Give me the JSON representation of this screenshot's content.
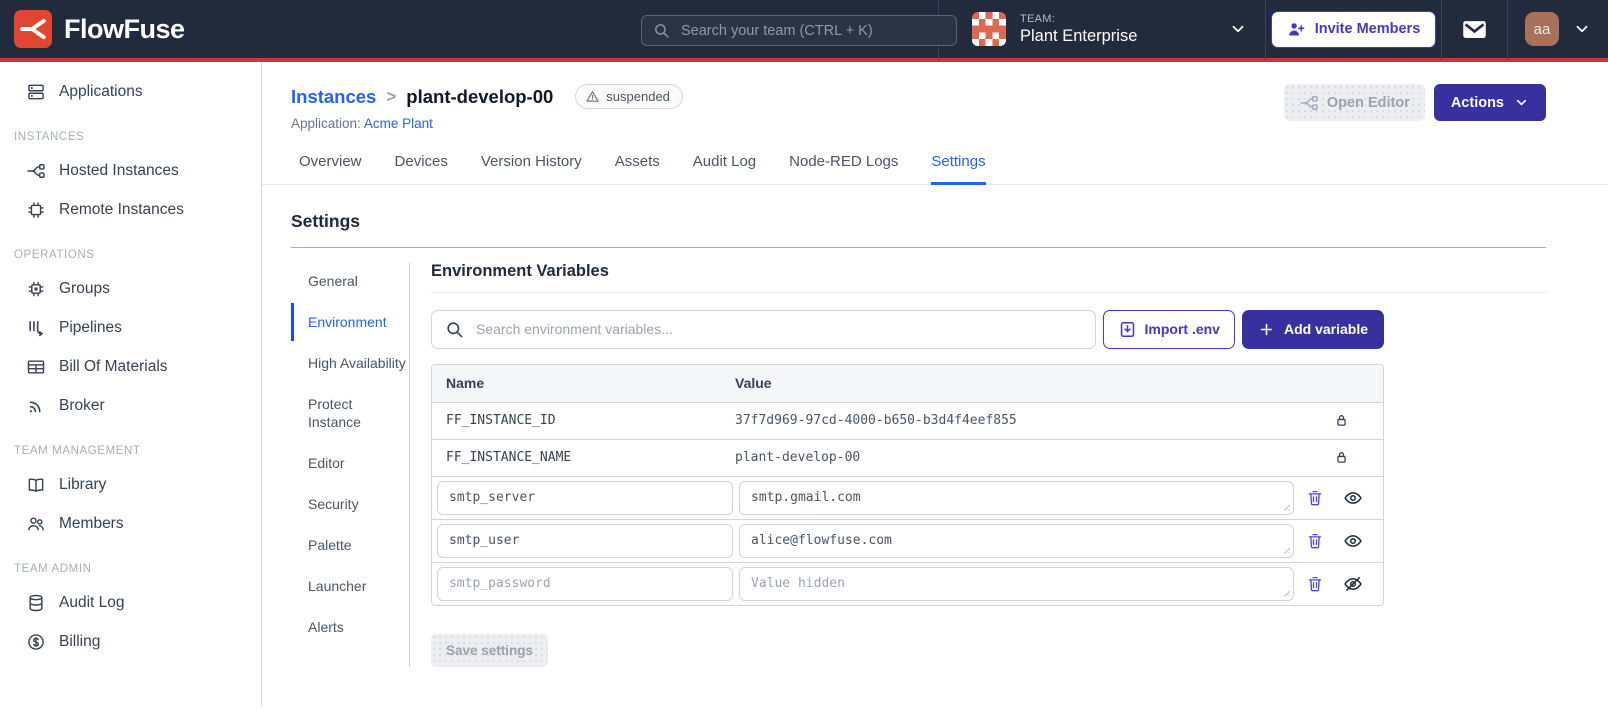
{
  "colors": {
    "header_bg": "#222B3B",
    "accent_red_line": "#C8373E",
    "logo_red": "#E14632",
    "link_blue": "#2563EB",
    "indigo_button": "#38309F",
    "indigo_outline": "#4338CA",
    "team_avatar_bg": "#DD6A50",
    "user_avatar_bg": "#A8715A"
  },
  "header": {
    "brand": "FlowFuse",
    "search_placeholder": "Search your team (CTRL + K)",
    "team_label": "TEAM:",
    "team_name": "Plant Enterprise",
    "invite_label": "Invite Members",
    "user_initials": "aa"
  },
  "sidebar": {
    "groups": [
      {
        "section": "",
        "items": [
          "Applications"
        ]
      },
      {
        "section": "INSTANCES",
        "items": [
          "Hosted Instances",
          "Remote Instances"
        ]
      },
      {
        "section": "OPERATIONS",
        "items": [
          "Groups",
          "Pipelines",
          "Bill Of Materials",
          "Broker"
        ]
      },
      {
        "section": "TEAM MANAGEMENT",
        "items": [
          "Library",
          "Members"
        ]
      },
      {
        "section": "TEAM ADMIN",
        "items": [
          "Audit Log",
          "Billing"
        ]
      }
    ]
  },
  "page": {
    "breadcrumb": {
      "parent": "Instances",
      "separator": ">",
      "current": "plant-develop-00"
    },
    "status_badge": "suspended",
    "application_label": "Application:",
    "application_name": "Acme Plant",
    "open_editor_label": "Open Editor",
    "actions_label": "Actions",
    "tabs": [
      "Overview",
      "Devices",
      "Version History",
      "Assets",
      "Audit Log",
      "Node-RED Logs",
      "Settings"
    ],
    "active_tab": "Settings"
  },
  "settings": {
    "title": "Settings",
    "nav": [
      "General",
      "Environment",
      "High Availability",
      "Protect Instance",
      "Editor",
      "Security",
      "Palette",
      "Launcher",
      "Alerts"
    ],
    "active_nav": "Environment",
    "env": {
      "heading": "Environment Variables",
      "search_placeholder": "Search environment variables...",
      "import_label": "Import .env",
      "add_label": "Add variable",
      "columns": {
        "name": "Name",
        "value": "Value"
      },
      "locked_rows": [
        {
          "name": "FF_INSTANCE_ID",
          "value": "37f7d969-97cd-4000-b650-b3d4f4eef855"
        },
        {
          "name": "FF_INSTANCE_NAME",
          "value": "plant-develop-00"
        }
      ],
      "editable_rows": [
        {
          "name": "smtp_server",
          "value": "smtp.gmail.com"
        },
        {
          "name": "smtp_user",
          "value": "alice@flowfuse.com"
        },
        {
          "name": "smtp_password",
          "value": "",
          "value_placeholder": "Value hidden"
        }
      ],
      "save_label": "Save settings"
    }
  }
}
